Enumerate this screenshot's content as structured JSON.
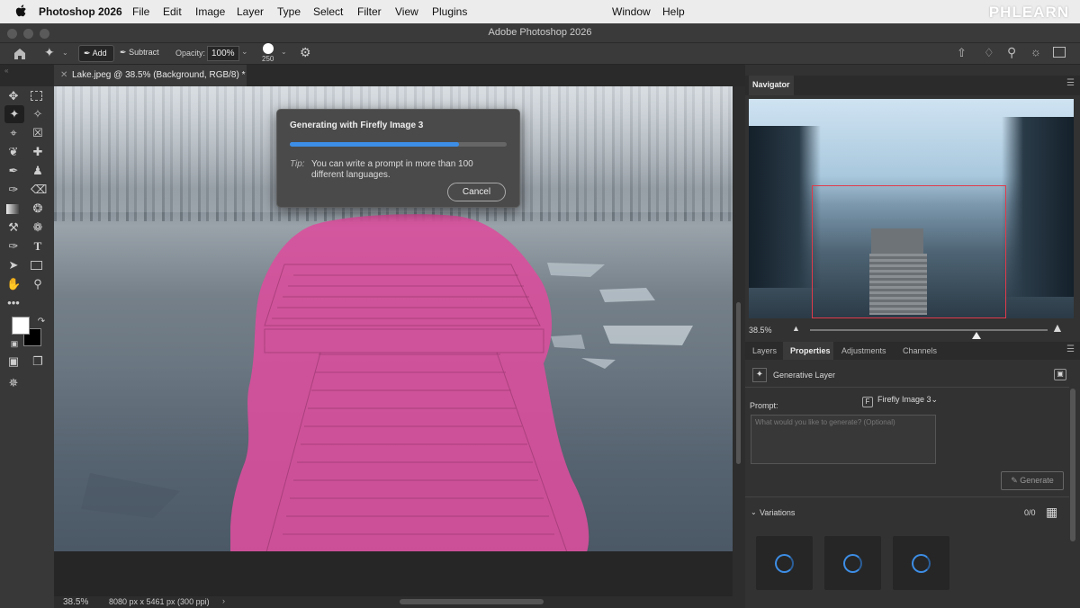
{
  "menubar": {
    "app": "Photoshop 2026",
    "items": [
      "File",
      "Edit",
      "Image",
      "Layer",
      "Type",
      "Select",
      "Filter",
      "View",
      "Plugins",
      "Window",
      "Help"
    ],
    "watermark": "PHLEARN"
  },
  "window": {
    "title": "Adobe Photoshop 2026"
  },
  "options": {
    "add_label": "Add",
    "subtract_label": "Subtract",
    "opacity_label": "Opacity:",
    "opacity_value": "100%",
    "brush_size": "250"
  },
  "document": {
    "tab_title": "Lake.jpeg @ 38.5% (Background, RGB/8) *"
  },
  "status": {
    "zoom": "38.5%",
    "dimensions": "8080 px x 5461 px (300 ppi)"
  },
  "dialog": {
    "title": "Generating with Firefly Image 3",
    "progress": 0.78,
    "tip_label": "Tip:",
    "tip_text": "You can write a prompt in more than 100 different languages.",
    "cancel_label": "Cancel"
  },
  "navigator": {
    "tab": "Navigator",
    "zoom": "38.5%"
  },
  "lower_panel": {
    "tabs": [
      "Layers",
      "Properties",
      "Adjustments",
      "Channels"
    ],
    "active_tab": "Properties",
    "layer_type": "Generative Layer",
    "prompt_label": "Prompt:",
    "model": "Firefly Image 3",
    "prompt_placeholder": "What would you like to generate? (Optional)",
    "generate_label": "Generate",
    "variations_label": "Variations",
    "variations_count": "0/0"
  },
  "colors": {
    "accent": "#3d8ee6",
    "mask": "#d94f9c"
  }
}
